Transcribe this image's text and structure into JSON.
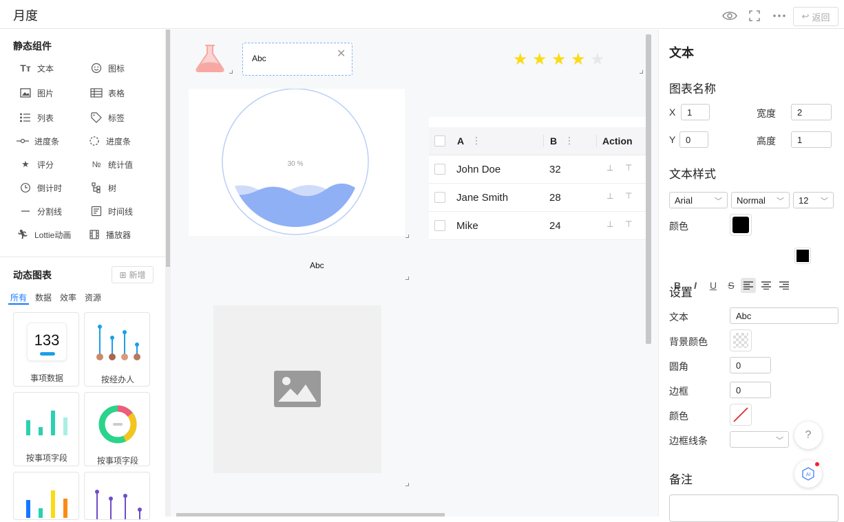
{
  "header": {
    "title": "月度",
    "back_label": "返回",
    "icons": [
      "eye-icon",
      "fullscreen-icon",
      "more-icon",
      "back-icon"
    ]
  },
  "static_components": {
    "title": "静态组件",
    "items": [
      {
        "label": "文本",
        "icon": "text-icon"
      },
      {
        "label": "图标",
        "icon": "smile-icon"
      },
      {
        "label": "图片",
        "icon": "image-icon"
      },
      {
        "label": "表格",
        "icon": "table-icon"
      },
      {
        "label": "列表",
        "icon": "list-icon"
      },
      {
        "label": "标签",
        "icon": "tag-icon"
      },
      {
        "label": "进度条",
        "icon": "progress-line-icon"
      },
      {
        "label": "进度条",
        "icon": "progress-circle-icon"
      },
      {
        "label": "评分",
        "icon": "star-icon"
      },
      {
        "label": "统计值",
        "icon": "number-icon"
      },
      {
        "label": "倒计时",
        "icon": "clock-icon"
      },
      {
        "label": "树",
        "icon": "tree-icon"
      },
      {
        "label": "分割线",
        "icon": "divider-icon"
      },
      {
        "label": "时间线",
        "icon": "timeline-icon"
      },
      {
        "label": "Lottie动画",
        "icon": "runner-icon"
      },
      {
        "label": "播放器",
        "icon": "film-icon"
      }
    ]
  },
  "dynamic_charts": {
    "title": "动态图表",
    "add_label": "新增",
    "tabs": [
      "所有",
      "数据",
      "效率",
      "资源"
    ],
    "active_tab": "所有",
    "cards": [
      {
        "caption": "事项数据",
        "value": "133"
      },
      {
        "caption": "按经办人"
      },
      {
        "caption": "按事项字段"
      },
      {
        "caption": "按事项字段"
      }
    ]
  },
  "canvas": {
    "text_box_value": "Abc",
    "rating": {
      "value": 4,
      "max": 5
    },
    "liquid_label": "30 %",
    "liquid_progress": 0.3,
    "caption_text": "Abc",
    "table": {
      "columns": [
        "A",
        "B",
        "Action"
      ],
      "rows": [
        {
          "name": "John Doe",
          "value": "32"
        },
        {
          "name": "Jane Smith",
          "value": "28"
        },
        {
          "name": "Mike",
          "value": "24"
        }
      ]
    }
  },
  "panel": {
    "heading": "文本",
    "chart_name_title": "图表名称",
    "x_label": "X",
    "x_value": "1",
    "y_label": "Y",
    "y_value": "0",
    "width_label": "宽度",
    "width_value": "2",
    "height_label": "高度",
    "height_value": "1",
    "text_style_title": "文本样式",
    "font_family": "Arial",
    "font_weight": "Normal",
    "font_size": "12",
    "color_label": "颜色",
    "text_color": "#000000",
    "format_buttons": [
      "bold-icon",
      "italic-icon",
      "underline-icon",
      "strikethrough-icon",
      "align-left-icon",
      "align-center-icon",
      "align-right-icon"
    ],
    "settings_title": "设置",
    "text_label": "文本",
    "text_value": "Abc",
    "bg_color_label": "背景颜色",
    "radius_label": "圆角",
    "radius_value": "0",
    "border_label": "边框",
    "border_value": "0",
    "border_color_label": "颜色",
    "border_line_label": "边框线条",
    "notes_title": "备注"
  },
  "colors": {
    "accent": "#1677ff",
    "star": "#fadb14",
    "wave": "#8fb0f5",
    "flask": "#f7a8a3"
  }
}
